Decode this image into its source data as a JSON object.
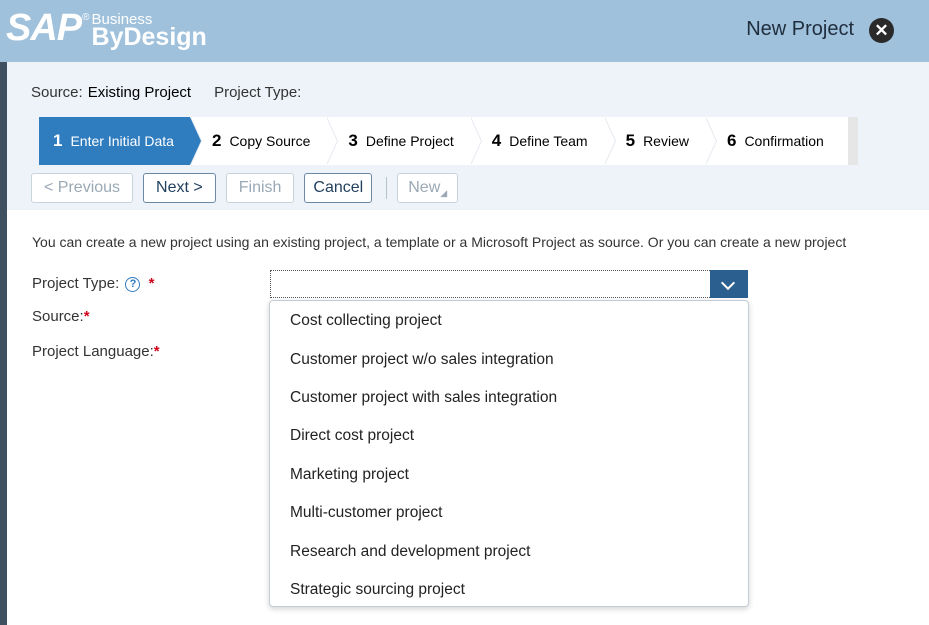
{
  "shell": {
    "logo_sap": "SAP",
    "logo_business": "Business",
    "logo_bydesign": "ByDesign",
    "title": "New Project",
    "close_icon": "close-circle-icon"
  },
  "info": {
    "source_label": "Source:",
    "source_value": "Existing Project",
    "project_type_label": "Project Type:"
  },
  "roadmap": [
    {
      "num": "1",
      "label": "Enter Initial Data",
      "active": true
    },
    {
      "num": "2",
      "label": "Copy Source",
      "active": false
    },
    {
      "num": "3",
      "label": "Define Project",
      "active": false
    },
    {
      "num": "4",
      "label": "Define Team",
      "active": false
    },
    {
      "num": "5",
      "label": "Review",
      "active": false
    },
    {
      "num": "6",
      "label": "Confirmation",
      "active": false
    }
  ],
  "toolbar": {
    "previous": "<  Previous",
    "next": "Next  >",
    "finish": "Finish",
    "cancel": "Cancel",
    "new": "New"
  },
  "intro_text": "You can create a new project using an existing project, a template or a Microsoft Project as source. Or you can create a new project",
  "form": {
    "project_type_label": "Project Type:",
    "source_label": "Source:",
    "language_label": "Project Language:",
    "required_mark": "*",
    "help_icon_glyph": "?",
    "project_type_value": ""
  },
  "dropdown_options": [
    "Cost collecting project",
    "Customer project w/o sales integration",
    "Customer project with sales integration",
    "Direct cost project",
    "Marketing project",
    "Multi-customer project",
    "Research and development project",
    "Strategic sourcing project"
  ],
  "colors": {
    "shell": "#9fc1dc",
    "active_step": "#2f7cbf",
    "dropdown_button": "#2a5f8f",
    "required": "#d0021b"
  }
}
